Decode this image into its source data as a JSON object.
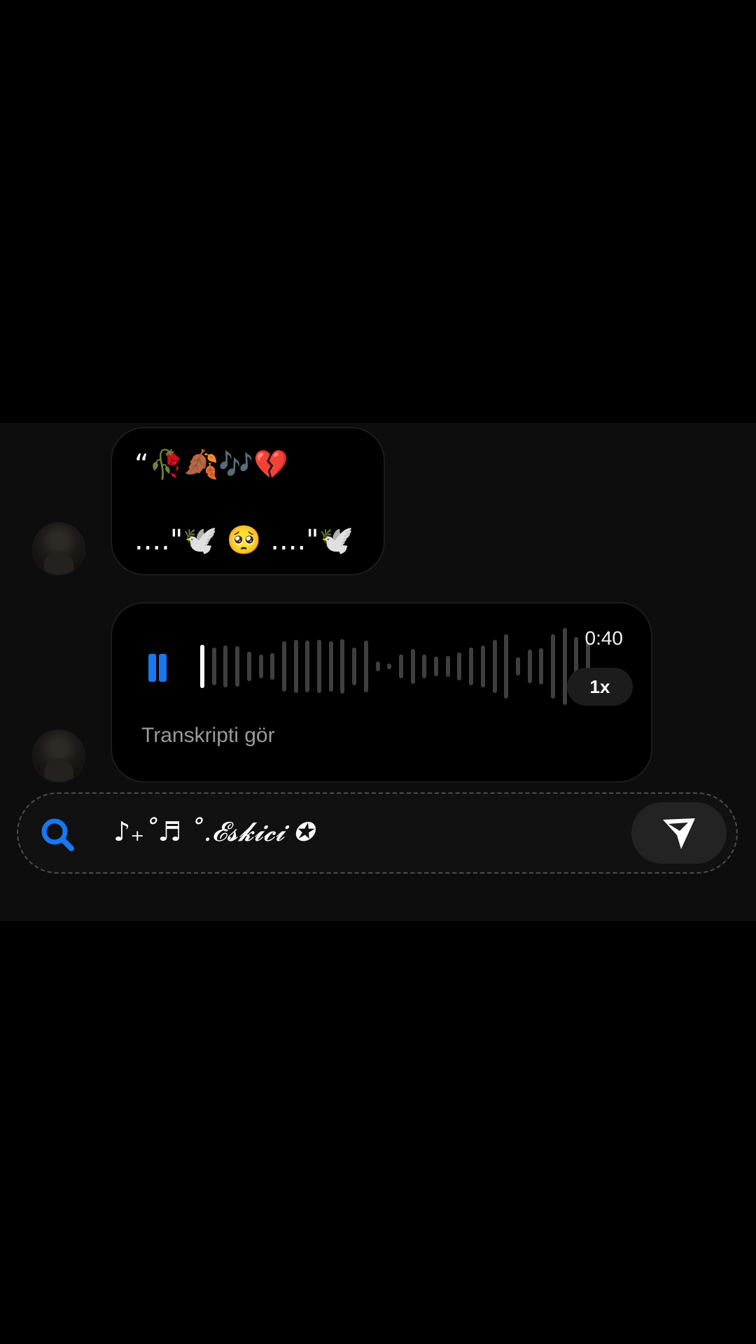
{
  "messages": [
    {
      "type": "text",
      "line1": "“🥀🍂🎶💔",
      "line2": "....\"🕊️  🥺  ....\"🕊️"
    },
    {
      "type": "voice",
      "duration": "0:40",
      "speed": "1x",
      "transcript_label": "Transkripti gör",
      "playback_progress": 0.0,
      "state": "playing"
    }
  ],
  "composer": {
    "text": "♪₊˚♬ ˚.𝓔𝓼𝓴𝓲𝓬𝓲 ✪"
  },
  "colors": {
    "accent": "#1877f2",
    "bubble_bg": "#000000",
    "panel_bg": "#0d0d0d",
    "muted_text": "#9a9a9a"
  },
  "icons": [
    "pause-icon",
    "search-icon",
    "send-icon",
    "avatar"
  ]
}
